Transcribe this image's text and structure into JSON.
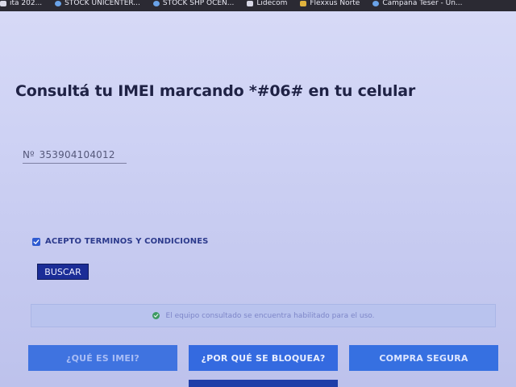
{
  "browser": {
    "bookmarks": [
      {
        "label": "ita 202...",
        "icon": "doc-icon"
      },
      {
        "label": "STOCK UNICENTER...",
        "icon": "globe-icon"
      },
      {
        "label": "STOCK SHP OCEN...",
        "icon": "globe-icon"
      },
      {
        "label": "Lidecom",
        "icon": "doc-icon"
      },
      {
        "label": "Flexxus Norte",
        "icon": "folder-icon"
      },
      {
        "label": "Campaña Teser - Un...",
        "icon": "globe-icon"
      }
    ]
  },
  "page": {
    "title": "Consultá tu IMEI marcando *#06# en tu celular"
  },
  "form": {
    "imei_prefix": "Nº",
    "imei_value": "353904104012",
    "terms_label": "ACEPTO TERMINOS Y CONDICIONES",
    "terms_checked": true,
    "search_button": "BUSCAR"
  },
  "result": {
    "message": "El equipo consultado se encuentra habilitado para el uso.",
    "status_color": "#3c9a63"
  },
  "info_buttons": {
    "what_is_imei": "¿QUÉ ES IMEI?",
    "why_blocked": "¿POR QUÉ SE BLOQUEA?",
    "safe_purchase": "COMPRA SEGURA"
  },
  "colors": {
    "accent": "#3a6fe0",
    "dark_button": "#1b2d97",
    "title": "#1f2245"
  }
}
